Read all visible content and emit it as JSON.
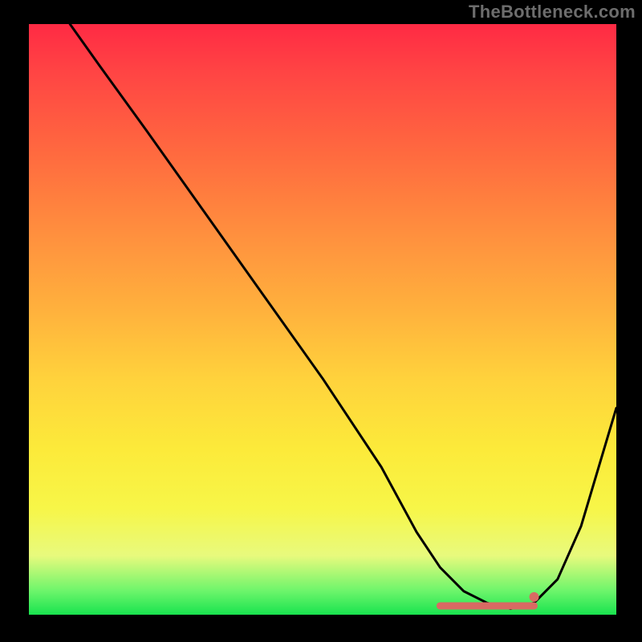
{
  "watermark": "TheBottleneck.com",
  "chart_data": {
    "type": "line",
    "title": "",
    "xlabel": "",
    "ylabel": "",
    "xlim": [
      0,
      100
    ],
    "ylim": [
      0,
      100
    ],
    "grid": false,
    "legend": false,
    "background_gradient": [
      "#ff2a44",
      "#ff6a3f",
      "#ffb03d",
      "#fcea3a",
      "#19e34f"
    ],
    "series": [
      {
        "name": "bottleneck-curve",
        "color": "#000000",
        "x": [
          7,
          12,
          20,
          30,
          40,
          50,
          60,
          66,
          70,
          74,
          78,
          82,
          86,
          90,
          94,
          100
        ],
        "y": [
          100,
          93,
          82,
          68,
          54,
          40,
          25,
          14,
          8,
          4,
          2,
          1,
          2,
          6,
          15,
          35
        ]
      }
    ],
    "highlight": {
      "name": "optimal-flat-region",
      "color": "#d96a63",
      "x_range": [
        70,
        86
      ],
      "y": 1.5,
      "end_dot": {
        "x": 86,
        "y": 3
      }
    }
  }
}
